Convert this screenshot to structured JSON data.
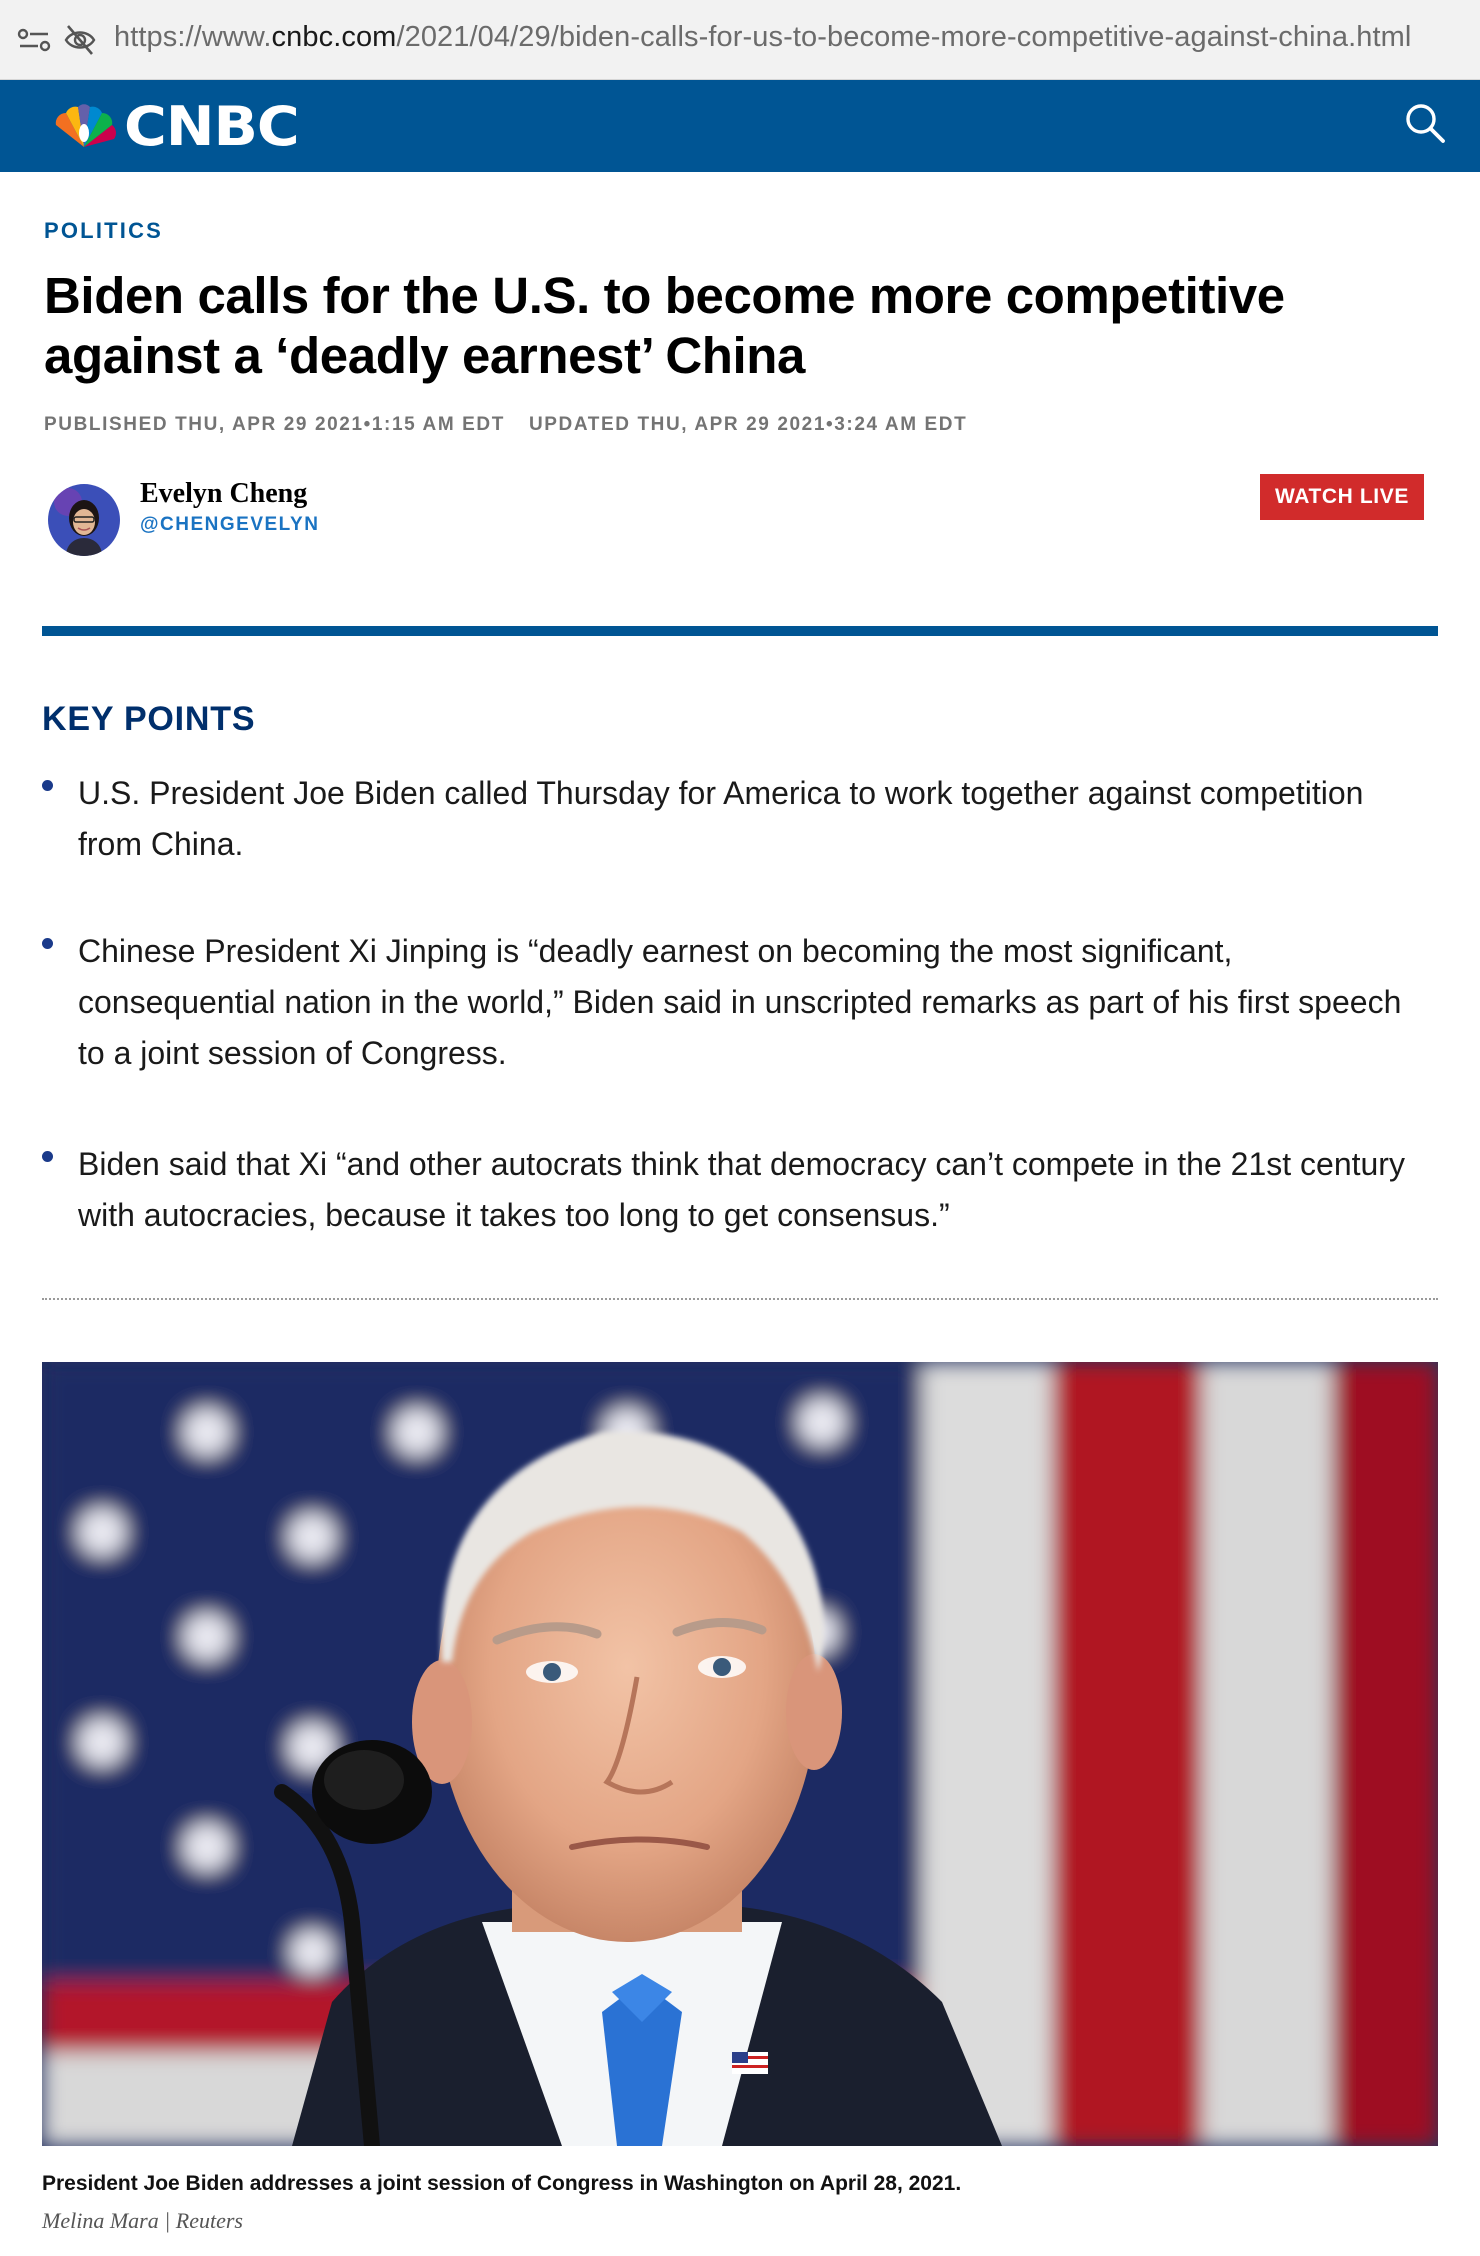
{
  "browser": {
    "url_prefix": "https://www.",
    "url_host": "cnbc.com",
    "url_path": "/2021/04/29/biden-calls-for-us-to-become-more-competitive-against-china.html",
    "icons": [
      "tune-icon",
      "eye-off-icon"
    ]
  },
  "header": {
    "logo_text": "CNBC",
    "logo_icon": "peacock-icon",
    "search_icon": "search-icon",
    "brand_color": "#005594"
  },
  "article": {
    "section": "POLITICS",
    "headline": "Biden calls for the U.S. to become more competitive against a ‘deadly earnest’ China",
    "published": "PUBLISHED THU, APR 29 2021•1:15 AM EDT",
    "updated": "UPDATED THU, APR 29 2021•3:24 AM EDT",
    "author_name": "Evelyn Cheng",
    "author_handle": "@CHENGEVELYN",
    "watch_live": "WATCH LIVE",
    "watch_live_color": "#d12b2b"
  },
  "key_points": {
    "title": "KEY POINTS",
    "items": [
      "U.S. President Joe Biden called Thursday for America to work together against competition from China.",
      "Chinese President Xi Jinping is “deadly earnest on becoming the most significant, consequential nation in the world,” Biden said in unscripted remarks as part of his first speech to a joint session of Congress.",
      "Biden said that Xi “and other autocrats think that democracy can’t compete in the 21st century with autocracies, because it takes too long to get consensus.”"
    ]
  },
  "photo": {
    "caption": "President Joe Biden addresses a joint session of Congress in Washington on April 28, 2021.",
    "credit": "Melina Mara | Reuters"
  }
}
